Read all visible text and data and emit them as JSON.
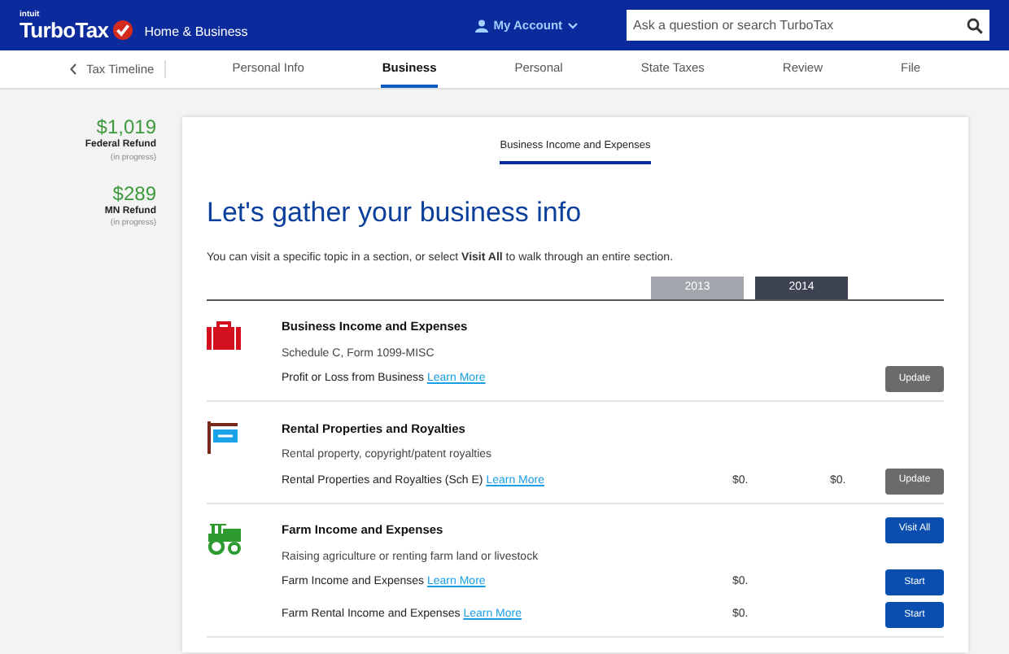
{
  "header": {
    "brand_small": "intuit",
    "brand": "TurboTax",
    "edition": "Home & Business",
    "account": "My Account",
    "search": {
      "placeholder": "Ask a question or search TurboTax"
    }
  },
  "nav": {
    "back": "Tax Timeline",
    "tabs": [
      {
        "label": "Personal Info",
        "selected": false
      },
      {
        "label": "Business",
        "selected": true
      },
      {
        "label": "Personal",
        "selected": false
      },
      {
        "label": "State Taxes",
        "selected": false
      },
      {
        "label": "Review",
        "selected": false
      },
      {
        "label": "File",
        "selected": false
      }
    ]
  },
  "refunds": [
    {
      "amount": "$1,019",
      "label": "Federal Refund",
      "status": "(in progress)"
    },
    {
      "amount": "$289",
      "label": "MN Refund",
      "status": "(in progress)"
    }
  ],
  "content": {
    "subtab": "Business Income and Expenses",
    "title": "Let's gather your business info",
    "intro": "You can visit a specific topic in a section, or select **Visit All** to walk through an entire section.",
    "years": [
      {
        "label": "2013",
        "selected": false
      },
      {
        "label": "2014",
        "selected": true
      }
    ],
    "sections": [
      {
        "kind": "briefcase",
        "title": "Business Income and Expenses",
        "subtitle": "Schedule C, Form 1099-MISC",
        "lines": [
          {
            "text": "Profit or Loss from Business",
            "link": "Learn More",
            "button": "Update",
            "kind": "update"
          }
        ]
      },
      {
        "kind": "rent",
        "title": "Rental Properties and Royalties",
        "subtitle": "Rental property, copyright/patent royalties",
        "lines": [
          {
            "text": "Rental Properties and Royalties (Sch E)",
            "link": "Learn More",
            "value_2013": "$0.",
            "value_2014": "$0.",
            "button": "Update",
            "kind": "update"
          }
        ]
      },
      {
        "kind": "tractor",
        "title": "Farm Income and Expenses",
        "title_button": "Visit All",
        "subtitle": "Raising agriculture or renting farm land or livestock",
        "lines": [
          {
            "text": "Farm Income and Expenses",
            "link": "Learn More",
            "value_2013": "$0.",
            "button": "Start",
            "kind": "start"
          },
          {
            "text": "Farm Rental Income and Expenses",
            "link": "Learn More",
            "value_2013": "$0.",
            "button": "Start",
            "kind": "start"
          }
        ]
      }
    ]
  }
}
